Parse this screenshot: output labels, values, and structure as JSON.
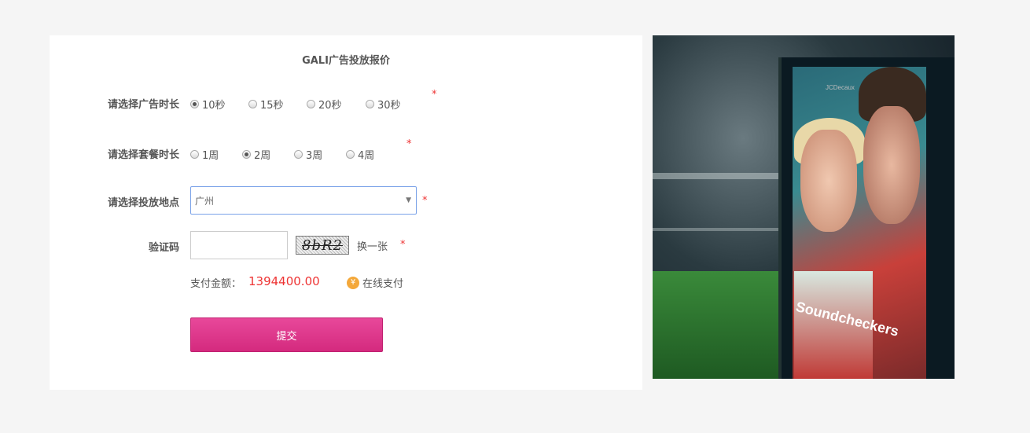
{
  "form": {
    "title": "GALI广告投放报价",
    "duration": {
      "label": "请选择广告时长",
      "options": [
        "10秒",
        "15秒",
        "20秒",
        "30秒"
      ],
      "selected": "10秒",
      "required_mark": "*"
    },
    "package": {
      "label": "请选择套餐时长",
      "options": [
        "1周",
        "2周",
        "3周",
        "4周"
      ],
      "selected": "2周",
      "required_mark": "*"
    },
    "location": {
      "label": "请选择投放地点",
      "value": "广州",
      "required_mark": "*"
    },
    "captcha": {
      "label": "验证码",
      "input_value": "",
      "image_text": "8bR2",
      "refresh_label": "换一张",
      "required_mark": "*"
    },
    "payment": {
      "label": "支付金额：",
      "amount": "1394400.00",
      "method_icon": "yen-coin-icon",
      "method_label": "在线支付",
      "method_icon_glyph": "¥"
    },
    "submit_label": "提交"
  },
  "photo": {
    "brand": "JCDecaux",
    "poster_text": "Soundcheckers"
  },
  "colors": {
    "accent": "#d42a7e",
    "required": "#ee3333",
    "amount": "#ee3333",
    "select_border": "#7aa2e8",
    "coin": "#f4a83a"
  }
}
